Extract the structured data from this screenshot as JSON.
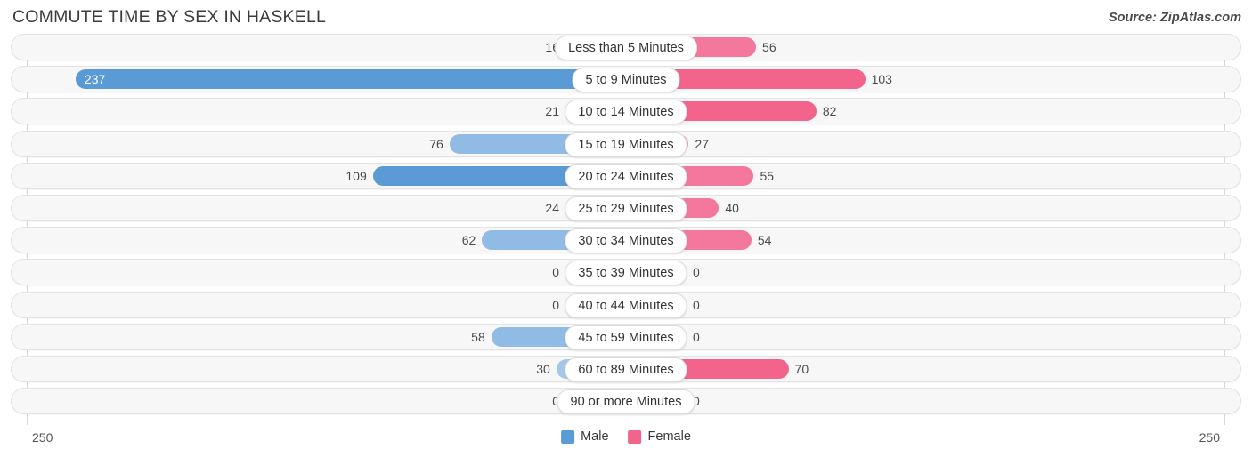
{
  "header": {
    "title": "COMMUTE TIME BY SEX IN HASKELL",
    "source": "Source: ZipAtlas.com"
  },
  "axis": {
    "left_max": "250",
    "right_max": "250"
  },
  "legend": {
    "items": [
      {
        "label": "Male",
        "color": "#5b9bd5"
      },
      {
        "label": "Female",
        "color": "#f2648c"
      }
    ]
  },
  "colors": {
    "male_strong": "#5b9bd5",
    "male_light": "#a6c8e8",
    "female_strong": "#f2648c",
    "female_light": "#f89ab5",
    "track_bg": "#f7f7f7",
    "track_border": "#e3e3e3",
    "axis_line": "#d8d8d8"
  },
  "chart_data": {
    "type": "bar",
    "orientation": "horizontal-diverging",
    "title": "COMMUTE TIME BY SEX IN HASKELL",
    "xlabel": "",
    "ylabel": "",
    "xlim": [
      250,
      250
    ],
    "axis_max": 250,
    "grid": false,
    "legend_position": "bottom-center",
    "categories": [
      "Less than 5 Minutes",
      "5 to 9 Minutes",
      "10 to 14 Minutes",
      "15 to 19 Minutes",
      "20 to 24 Minutes",
      "25 to 29 Minutes",
      "30 to 34 Minutes",
      "35 to 39 Minutes",
      "40 to 44 Minutes",
      "45 to 59 Minutes",
      "60 to 89 Minutes",
      "90 or more Minutes"
    ],
    "series": [
      {
        "name": "Male",
        "color": "#5b9bd5",
        "values": [
          16,
          237,
          21,
          76,
          109,
          24,
          62,
          0,
          0,
          58,
          30,
          0
        ]
      },
      {
        "name": "Female",
        "color": "#f2648c",
        "values": [
          56,
          103,
          82,
          27,
          55,
          40,
          54,
          0,
          0,
          0,
          70,
          0
        ]
      }
    ]
  },
  "rows": [
    {
      "label": "Less than 5 Minutes",
      "male": "16",
      "female": "56",
      "male_val": 16,
      "female_val": 56,
      "male_inside": false
    },
    {
      "label": "5 to 9 Minutes",
      "male": "237",
      "female": "103",
      "male_val": 237,
      "female_val": 103,
      "male_inside": true
    },
    {
      "label": "10 to 14 Minutes",
      "male": "21",
      "female": "82",
      "male_val": 21,
      "female_val": 82,
      "male_inside": false
    },
    {
      "label": "15 to 19 Minutes",
      "male": "76",
      "female": "27",
      "male_val": 76,
      "female_val": 27,
      "male_inside": false
    },
    {
      "label": "20 to 24 Minutes",
      "male": "109",
      "female": "55",
      "male_val": 109,
      "female_val": 55,
      "male_inside": false
    },
    {
      "label": "25 to 29 Minutes",
      "male": "24",
      "female": "40",
      "male_val": 24,
      "female_val": 40,
      "male_inside": false
    },
    {
      "label": "30 to 34 Minutes",
      "male": "62",
      "female": "54",
      "male_val": 62,
      "female_val": 54,
      "male_inside": false
    },
    {
      "label": "35 to 39 Minutes",
      "male": "0",
      "female": "0",
      "male_val": 0,
      "female_val": 0,
      "male_inside": false
    },
    {
      "label": "40 to 44 Minutes",
      "male": "0",
      "female": "0",
      "male_val": 0,
      "female_val": 0,
      "male_inside": false
    },
    {
      "label": "45 to 59 Minutes",
      "male": "58",
      "female": "0",
      "male_val": 58,
      "female_val": 0,
      "male_inside": false
    },
    {
      "label": "60 to 89 Minutes",
      "male": "30",
      "female": "70",
      "male_val": 30,
      "female_val": 70,
      "male_inside": false
    },
    {
      "label": "90 or more Minutes",
      "male": "0",
      "female": "0",
      "male_val": 0,
      "female_val": 0,
      "male_inside": false
    }
  ]
}
